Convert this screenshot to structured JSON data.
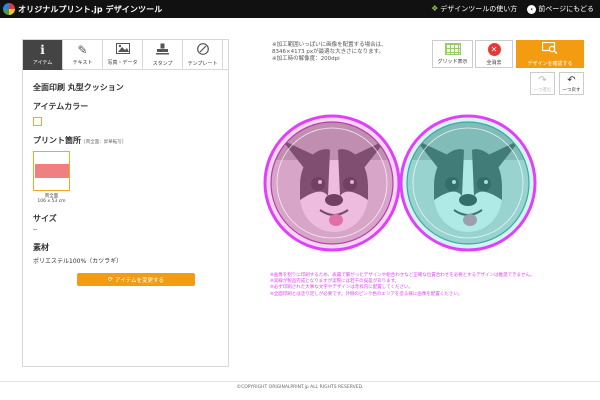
{
  "header": {
    "logo_text": "オリジナルプリント.jp デザインツール",
    "guide_label": "デザインツールの使い方",
    "back_label": "前ページにもどる"
  },
  "left_panel": {
    "tabs": [
      {
        "label": "アイテム",
        "icon": "info-icon",
        "active": true
      },
      {
        "label": "テキスト",
        "icon": "pen-icon",
        "active": false
      },
      {
        "label": "写真・データ",
        "icon": "image-icon",
        "active": false
      },
      {
        "label": "スタンプ",
        "icon": "stamp-icon",
        "active": false
      },
      {
        "label": "テンプレート",
        "icon": "template-icon",
        "active": false
      }
    ],
    "item_title": "全面印刷 丸型クッション",
    "color_label": "アイテムカラー",
    "print_label": "プリント箇所",
    "print_note": "[両全面：昇華転写]",
    "print_thumb_label": "両全面",
    "print_thumb_size": "106 x 53 cm",
    "size_label": "サイズ",
    "size_value": "--",
    "material_label": "素材",
    "material_value": "ポリエステル100%（カツラギ）",
    "change_button": "アイテムを変更する"
  },
  "notes_top": [
    "※加工範囲いっぱいに画像を配置する場合は、",
    "8346×4173 pxが最適な大きさになります。",
    "※加工時の解像度：200dpi"
  ],
  "toolbar": {
    "grid_label": "グリッド表示",
    "clear_label": "全消去",
    "confirm_label": "デザインを確認する",
    "redo_label": "一つ進む",
    "undo_label": "一つ戻す"
  },
  "warnings": [
    "※画像を割りに印刷するため、表裏で繋がったデザインや組合わせなど正確な位置合わせを必要とするデザインは推奨できません。",
    "※実線が製品完成となりますが実際には若干の誤差があります。",
    "※必ず印刷された大事な文字やデザインは赤枠内に配置してください。",
    "※全面印刷とは塗り足しが必要です。外側のピンク色のエリアを塗る様に画像を配置ください。"
  ],
  "footer": {
    "copyright": "©COPYRIGHT ORIGINALPRINT.jp ALL RIGHTS RESERVED."
  },
  "colors": {
    "accent_orange": "#f39c12",
    "header_bg": "#111111",
    "bleed_magenta": "#e040fb",
    "left_tint": "#e879c7",
    "right_tint": "#5ee0d8"
  }
}
